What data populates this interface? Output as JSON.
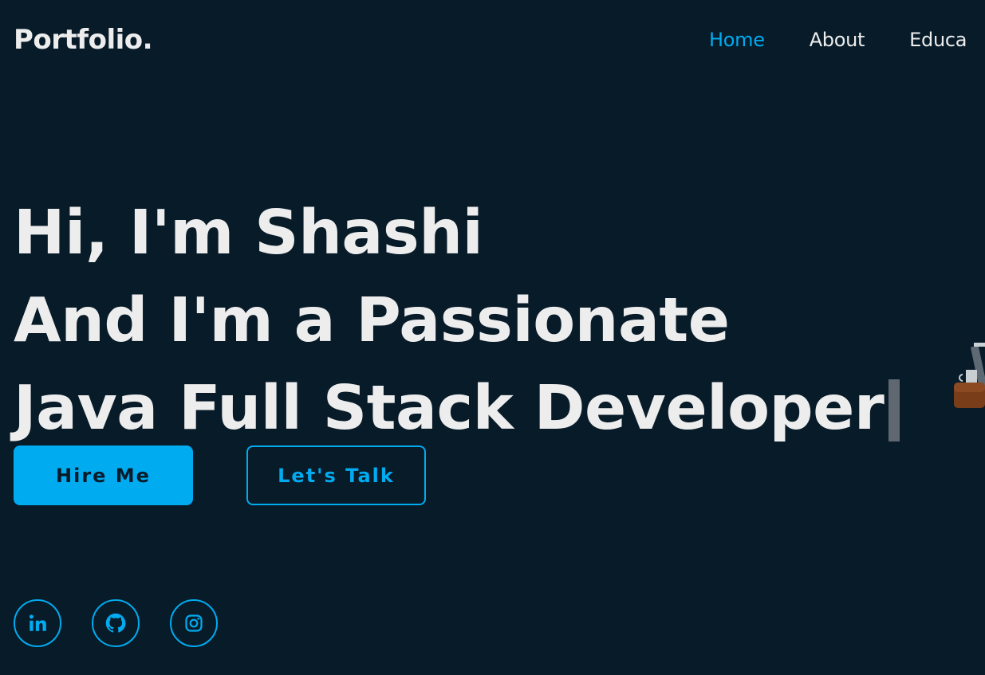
{
  "header": {
    "logo": "Portfolio.",
    "nav": [
      {
        "label": "Home",
        "active": true
      },
      {
        "label": "About",
        "active": false
      },
      {
        "label": "Educa",
        "active": false
      }
    ]
  },
  "hero": {
    "line1": "Hi, I'm Shashi",
    "line2": "And I'm a Passionate",
    "line3": "Java Full Stack Developer"
  },
  "buttons": {
    "hire": "Hire Me",
    "talk": "Let's Talk"
  },
  "socials": [
    {
      "icon": "linkedin-icon"
    },
    {
      "icon": "github-icon"
    },
    {
      "icon": "instagram-icon"
    }
  ],
  "colors": {
    "background": "#081b29",
    "accent": "#00abf0",
    "text": "#ededed"
  }
}
